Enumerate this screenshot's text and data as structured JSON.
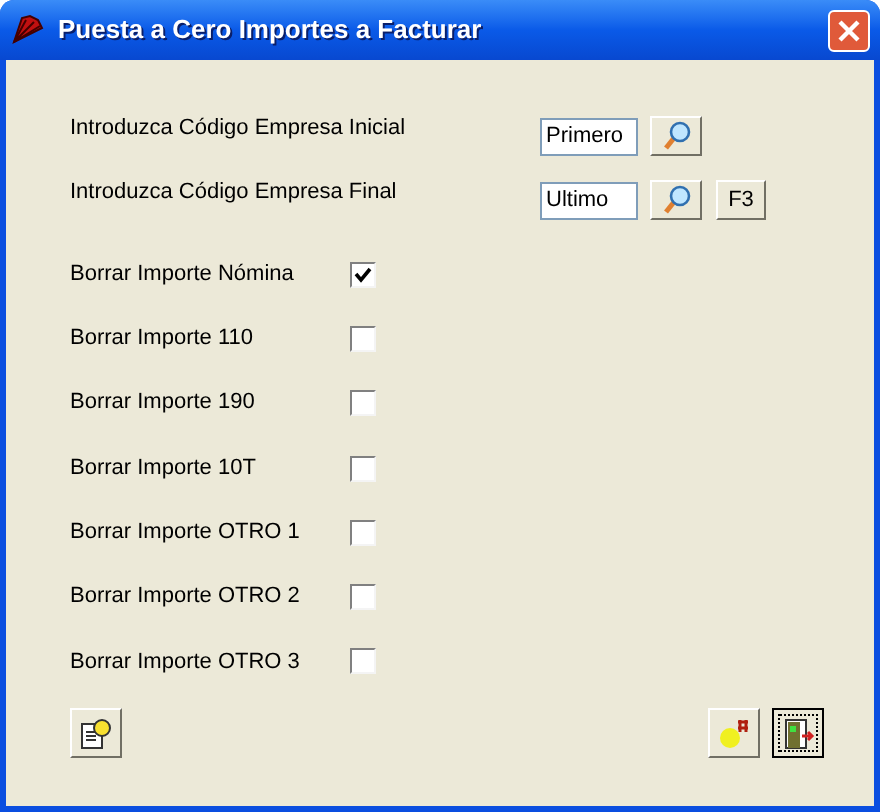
{
  "window": {
    "title": "Puesta a Cero Importes a Facturar"
  },
  "code_fields": [
    {
      "label": "Introduzca Código Empresa Inicial",
      "value": "Primero"
    },
    {
      "label": "Introduzca Código Empresa Final",
      "value": "Ultimo",
      "extra_key": "F3"
    }
  ],
  "options": [
    {
      "label": "Borrar Importe Nómina",
      "checked": true
    },
    {
      "label": "Borrar Importe 110",
      "checked": false
    },
    {
      "label": "Borrar Importe 190",
      "checked": false
    },
    {
      "label": "Borrar Importe 10T",
      "checked": false
    },
    {
      "label": "Borrar Importe OTRO 1",
      "checked": false
    },
    {
      "label": "Borrar Importe OTRO 2",
      "checked": false
    },
    {
      "label": "Borrar Importe OTRO 3",
      "checked": false
    }
  ]
}
